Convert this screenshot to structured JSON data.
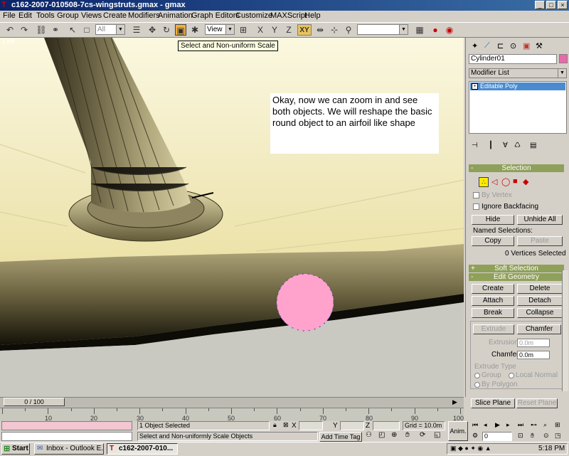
{
  "window": {
    "title": "c162-2007-010508-7cs-wingstruts.gmax - gmax",
    "minimize": "_",
    "maximize": "□",
    "close": "×"
  },
  "menu": [
    "File",
    "Edit",
    "Tools",
    "Group",
    "Views",
    "Create",
    "Modifiers",
    "Animation",
    "Graph Editors",
    "Customize",
    "MAXScript",
    "Help"
  ],
  "toolbar": {
    "selection_filter": "All",
    "reference_coord": "View",
    "axis_xy": "XY",
    "tooltip": "Select and Non-uniform Scale"
  },
  "viewport": {
    "label": "Left",
    "note": "Okay, now we can zoom in and see both objects.  We will reshape the basic round object to an airfoil like shape"
  },
  "command_panel": {
    "object_name": "Cylinder01",
    "object_color": "#e86aa8",
    "modifier_list": "Modifier List",
    "stack_item": "Editable Poly",
    "selection": {
      "title": "Selection",
      "by_vertex": "By Vertex",
      "ignore_backfacing": "Ignore Backfacing",
      "hide": "Hide",
      "unhide_all": "Unhide All",
      "named_selections": "Named Selections:",
      "copy": "Copy",
      "paste": "Paste",
      "status": "0 Vertices Selected"
    },
    "soft_selection": "Soft Selection",
    "edit_geometry": {
      "title": "Edit Geometry",
      "create": "Create",
      "delete": "Delete",
      "attach": "Attach",
      "detach": "Detach",
      "break": "Break",
      "collapse": "Collapse",
      "extrude": "Extrude",
      "chamfer": "Chamfer",
      "extrusion_label": "Extrusion",
      "extrusion_value": "0.0m",
      "chamfer_label": "Chamfer",
      "chamfer_value": "0.0m",
      "extrude_type": "Extrude Type",
      "group": "Group",
      "local_normal": "Local Normal",
      "by_polygon": "By Polygon",
      "slice_plane": "Slice Plane",
      "reset_plane": "Reset Plane"
    }
  },
  "timeline": {
    "slider": "0 / 100",
    "ticks": [
      "10",
      "20",
      "30",
      "40",
      "50",
      "60",
      "70",
      "80",
      "90",
      "100"
    ]
  },
  "status": {
    "selected": "1 Object Selected",
    "prompt": "Select and Non-uniformly Scale Objects",
    "x_label": "X",
    "y_label": "Y",
    "z_label": "Z",
    "grid": "Grid = 10.0m",
    "add_time_tag": "Add Time Tag",
    "anim": "Anim.",
    "frame": "0"
  },
  "taskbar": {
    "start": "Start",
    "task1": "Inbox - Outlook E...",
    "task2": "c162-2007-010...",
    "clock": "5:18 PM"
  }
}
